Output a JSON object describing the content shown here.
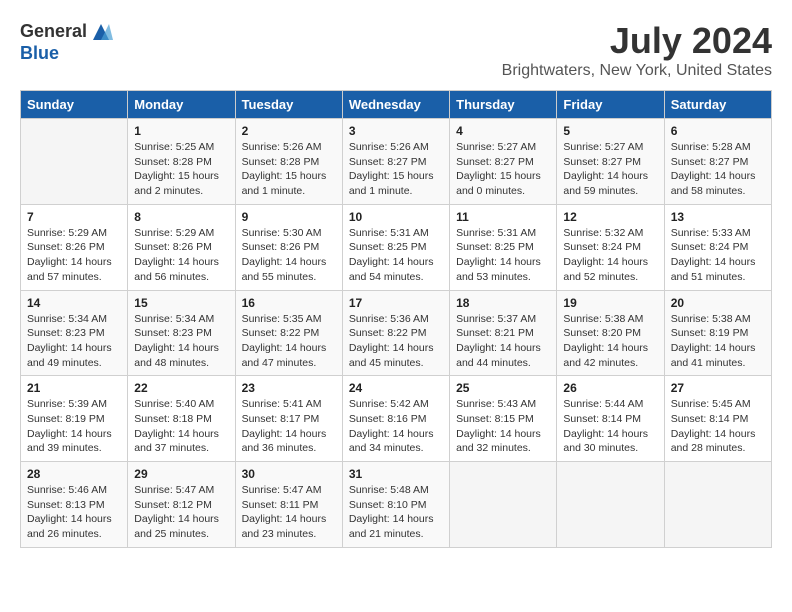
{
  "header": {
    "logo_general": "General",
    "logo_blue": "Blue",
    "title": "July 2024",
    "subtitle": "Brightwaters, New York, United States"
  },
  "days_of_week": [
    "Sunday",
    "Monday",
    "Tuesday",
    "Wednesday",
    "Thursday",
    "Friday",
    "Saturday"
  ],
  "weeks": [
    [
      {
        "day": "",
        "info": ""
      },
      {
        "day": "1",
        "info": "Sunrise: 5:25 AM\nSunset: 8:28 PM\nDaylight: 15 hours\nand 2 minutes."
      },
      {
        "day": "2",
        "info": "Sunrise: 5:26 AM\nSunset: 8:28 PM\nDaylight: 15 hours\nand 1 minute."
      },
      {
        "day": "3",
        "info": "Sunrise: 5:26 AM\nSunset: 8:27 PM\nDaylight: 15 hours\nand 1 minute."
      },
      {
        "day": "4",
        "info": "Sunrise: 5:27 AM\nSunset: 8:27 PM\nDaylight: 15 hours\nand 0 minutes."
      },
      {
        "day": "5",
        "info": "Sunrise: 5:27 AM\nSunset: 8:27 PM\nDaylight: 14 hours\nand 59 minutes."
      },
      {
        "day": "6",
        "info": "Sunrise: 5:28 AM\nSunset: 8:27 PM\nDaylight: 14 hours\nand 58 minutes."
      }
    ],
    [
      {
        "day": "7",
        "info": "Sunrise: 5:29 AM\nSunset: 8:26 PM\nDaylight: 14 hours\nand 57 minutes."
      },
      {
        "day": "8",
        "info": "Sunrise: 5:29 AM\nSunset: 8:26 PM\nDaylight: 14 hours\nand 56 minutes."
      },
      {
        "day": "9",
        "info": "Sunrise: 5:30 AM\nSunset: 8:26 PM\nDaylight: 14 hours\nand 55 minutes."
      },
      {
        "day": "10",
        "info": "Sunrise: 5:31 AM\nSunset: 8:25 PM\nDaylight: 14 hours\nand 54 minutes."
      },
      {
        "day": "11",
        "info": "Sunrise: 5:31 AM\nSunset: 8:25 PM\nDaylight: 14 hours\nand 53 minutes."
      },
      {
        "day": "12",
        "info": "Sunrise: 5:32 AM\nSunset: 8:24 PM\nDaylight: 14 hours\nand 52 minutes."
      },
      {
        "day": "13",
        "info": "Sunrise: 5:33 AM\nSunset: 8:24 PM\nDaylight: 14 hours\nand 51 minutes."
      }
    ],
    [
      {
        "day": "14",
        "info": "Sunrise: 5:34 AM\nSunset: 8:23 PM\nDaylight: 14 hours\nand 49 minutes."
      },
      {
        "day": "15",
        "info": "Sunrise: 5:34 AM\nSunset: 8:23 PM\nDaylight: 14 hours\nand 48 minutes."
      },
      {
        "day": "16",
        "info": "Sunrise: 5:35 AM\nSunset: 8:22 PM\nDaylight: 14 hours\nand 47 minutes."
      },
      {
        "day": "17",
        "info": "Sunrise: 5:36 AM\nSunset: 8:22 PM\nDaylight: 14 hours\nand 45 minutes."
      },
      {
        "day": "18",
        "info": "Sunrise: 5:37 AM\nSunset: 8:21 PM\nDaylight: 14 hours\nand 44 minutes."
      },
      {
        "day": "19",
        "info": "Sunrise: 5:38 AM\nSunset: 8:20 PM\nDaylight: 14 hours\nand 42 minutes."
      },
      {
        "day": "20",
        "info": "Sunrise: 5:38 AM\nSunset: 8:19 PM\nDaylight: 14 hours\nand 41 minutes."
      }
    ],
    [
      {
        "day": "21",
        "info": "Sunrise: 5:39 AM\nSunset: 8:19 PM\nDaylight: 14 hours\nand 39 minutes."
      },
      {
        "day": "22",
        "info": "Sunrise: 5:40 AM\nSunset: 8:18 PM\nDaylight: 14 hours\nand 37 minutes."
      },
      {
        "day": "23",
        "info": "Sunrise: 5:41 AM\nSunset: 8:17 PM\nDaylight: 14 hours\nand 36 minutes."
      },
      {
        "day": "24",
        "info": "Sunrise: 5:42 AM\nSunset: 8:16 PM\nDaylight: 14 hours\nand 34 minutes."
      },
      {
        "day": "25",
        "info": "Sunrise: 5:43 AM\nSunset: 8:15 PM\nDaylight: 14 hours\nand 32 minutes."
      },
      {
        "day": "26",
        "info": "Sunrise: 5:44 AM\nSunset: 8:14 PM\nDaylight: 14 hours\nand 30 minutes."
      },
      {
        "day": "27",
        "info": "Sunrise: 5:45 AM\nSunset: 8:14 PM\nDaylight: 14 hours\nand 28 minutes."
      }
    ],
    [
      {
        "day": "28",
        "info": "Sunrise: 5:46 AM\nSunset: 8:13 PM\nDaylight: 14 hours\nand 26 minutes."
      },
      {
        "day": "29",
        "info": "Sunrise: 5:47 AM\nSunset: 8:12 PM\nDaylight: 14 hours\nand 25 minutes."
      },
      {
        "day": "30",
        "info": "Sunrise: 5:47 AM\nSunset: 8:11 PM\nDaylight: 14 hours\nand 23 minutes."
      },
      {
        "day": "31",
        "info": "Sunrise: 5:48 AM\nSunset: 8:10 PM\nDaylight: 14 hours\nand 21 minutes."
      },
      {
        "day": "",
        "info": ""
      },
      {
        "day": "",
        "info": ""
      },
      {
        "day": "",
        "info": ""
      }
    ]
  ]
}
